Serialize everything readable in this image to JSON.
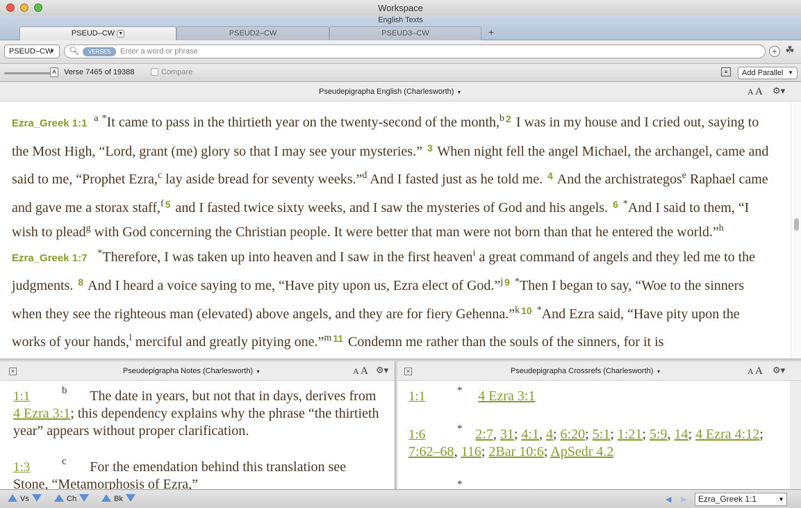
{
  "window": {
    "title": "Workspace",
    "subtitle": "English Texts"
  },
  "tabs": [
    {
      "label": "PSEUD–CW",
      "active": true
    },
    {
      "label": "PSEUD2–CW",
      "active": false
    },
    {
      "label": "PSEUD3–CW",
      "active": false
    }
  ],
  "toolbar": {
    "module": "PSEUD–CW",
    "search_scope": "VERSES",
    "search_placeholder": "Enter a word or phrase"
  },
  "versebar": {
    "slider_knob": "A",
    "verse_position": "Verse 7465 of 19388",
    "compare_label": "Compare",
    "add_parallel": "Add Parallel"
  },
  "main_pane": {
    "title": "Pseudepigrapha English (Charlesworth)",
    "text_size_small": "A",
    "text_size_large": "A",
    "lines": {
      "ref1": "Ezra_Greek 1:1",
      "s1": "It came to pass in the thirtieth year on the twenty-second of the month,",
      "s2": " I was in my house and I cried out, saying to the Most High, “Lord, grant (me) glory so that I may see your mysteries.”",
      "s3": " When night fell the angel Michael, the archangel, came and said to me, “Prophet Ezra,",
      "s3b": " lay aside bread for seventy weeks.”",
      "s4": " And I fasted just as he told me.",
      "s4b": " And the archistrategos",
      "s4c": " Raphael came and gave me a storax staff,",
      "s5": " and I fasted twice sixty weeks, and I saw the mysteries of God and his angels.",
      "s6": "And I said to them, “I wish to plead",
      "s6b": " with God concerning the Christian people. It were better that man were not born than that he entered the world.”",
      "ref7": "Ezra_Greek 1:7",
      "s7": "Therefore, I was taken up into heaven and I saw in the first heaven",
      "s7b": " a great command of angels and they led me to the judgments.",
      "s8": " And I heard a voice saying to me, “Have pity upon us, Ezra elect of God.”",
      "s9": "Then I began to say, “Woe to the sinners when they see the righteous man (elevated) above angels, and they are for fiery Gehenna.”",
      "s10": "And Ezra said, “Have pity upon the works of your hands,",
      "s10b": " merciful and greatly pitying one.”",
      "s11": " Condemn me rather than the souls of the sinners, for it is"
    },
    "verse_numbers": {
      "v2": "2",
      "v3": "3",
      "v4": "4",
      "v5": "5",
      "v6": "6",
      "v8": "8",
      "v9": "9",
      "v10": "10",
      "v11": "11"
    },
    "markers": {
      "a": "a",
      "b": "b",
      "c": "c",
      "d": "d",
      "e": "e",
      "f": "f",
      "g": "g",
      "h": "h",
      "i": "i",
      "j": "j",
      "k": "k",
      "l": "l",
      "m": "m",
      "star": "*"
    }
  },
  "notes_pane": {
    "title": "Pseudepigrapha Notes (Charlesworth)",
    "notes": [
      {
        "ref": "1:1",
        "mark": "b",
        "text_a": "The date in years, but not that in days, derives from ",
        "link": "4 Ezra 3:1",
        "text_b": "; this dependency explains why the phrase “the thirtieth year” appears without proper clarification."
      },
      {
        "ref": "1:3",
        "mark": "c",
        "text_a": "For the emendation behind this translation see Stone, “Metamorphosis of Ezra,”"
      }
    ]
  },
  "crossrefs_pane": {
    "title": "Pseudepigrapha Crossrefs (Charlesworth)",
    "refs": [
      {
        "ref": "1:1",
        "mark": "*",
        "links": [
          "4 Ezra 3:1"
        ]
      },
      {
        "ref": "1:6",
        "mark": "*",
        "links": [
          "2:7",
          "31",
          "4:1",
          "4",
          "6:20",
          "5:1",
          "1:21",
          "5:9",
          "14",
          "4 Ezra 4:12",
          "7:62–68",
          "116",
          "2Bar 10:6",
          "ApSedr 4.2"
        ]
      },
      {
        "ref": "",
        "mark": "*"
      }
    ]
  },
  "bottombar": {
    "nav": [
      "Vs",
      "Ch",
      "Bk"
    ],
    "goto_value": "Ezra_Greek 1:1"
  },
  "colors": {
    "accent": "#8a9a2a",
    "text": "#4a3621",
    "nav_blue": "#5b8fd0"
  }
}
